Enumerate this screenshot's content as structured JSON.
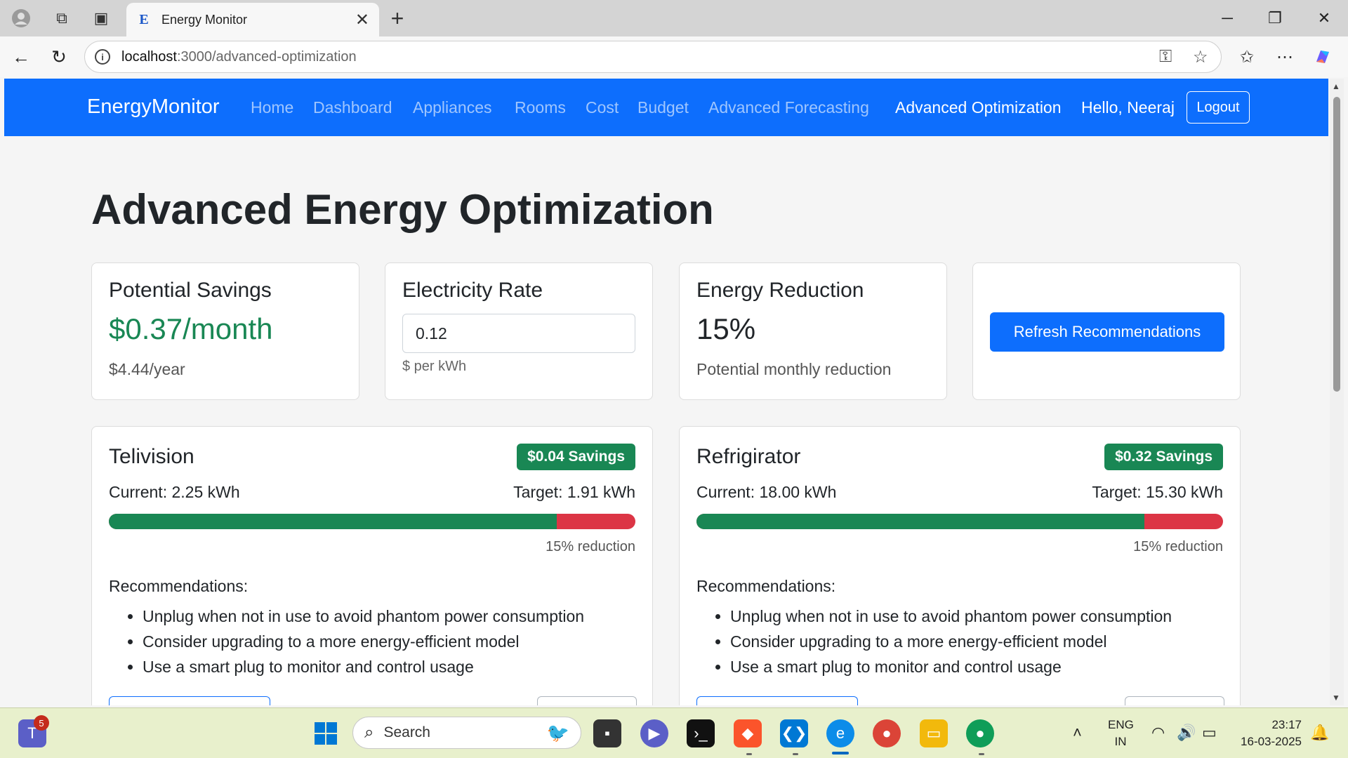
{
  "browser": {
    "tab_title": "Energy Monitor",
    "tab_favicon": "E",
    "url_host": "localhost",
    "url_path": ":3000/advanced-optimization"
  },
  "navbar": {
    "brand": "EnergyMonitor",
    "links": [
      "Home",
      "Dashboard",
      "Appliances",
      "Rooms",
      "Cost",
      "Budget",
      "Advanced Forecasting",
      "Advanced Optimization"
    ],
    "active": "Advanced Optimization",
    "greeting": "Hello, Neeraj",
    "logout": "Logout"
  },
  "page": {
    "title": "Advanced Energy Optimization"
  },
  "summary": {
    "savings": {
      "heading": "Potential Savings",
      "monthly": "$0.37/month",
      "yearly": "$4.44/year"
    },
    "rate": {
      "heading": "Electricity Rate",
      "value": "0.12",
      "help": "$ per kWh"
    },
    "reduction": {
      "heading": "Energy Reduction",
      "value": "15%",
      "caption": "Potential monthly reduction"
    },
    "refresh_label": "Refresh Recommendations"
  },
  "appliances": [
    {
      "name": "Telivision",
      "badge": "$0.04 Savings",
      "current": "Current: 2.25 kWh",
      "target": "Target: 1.91 kWh",
      "target_fraction": 0.85,
      "reduction_text": "15% reduction",
      "recommendations_heading": "Recommendations:",
      "recommendations": [
        "Unplug when not in use to avoid phantom power consumption",
        "Consider upgrading to a more energy-efficient model",
        "Use a smart plug to monitor and control usage"
      ]
    },
    {
      "name": "Refrigirator",
      "badge": "$0.32 Savings",
      "current": "Current: 18.00 kWh",
      "target": "Target: 15.30 kWh",
      "target_fraction": 0.85,
      "reduction_text": "15% reduction",
      "recommendations_heading": "Recommendations:",
      "recommendations": [
        "Unplug when not in use to avoid phantom power consumption",
        "Consider upgrading to a more energy-efficient model",
        "Use a smart plug to monitor and control usage"
      ]
    }
  ],
  "colors": {
    "primary": "#0d6efd",
    "success": "#198754",
    "danger": "#dc3545"
  },
  "taskbar": {
    "search_placeholder": "Search",
    "teams_badge": "5",
    "lang": "ENG",
    "region": "IN",
    "time": "23:17",
    "date": "16-03-2025"
  }
}
